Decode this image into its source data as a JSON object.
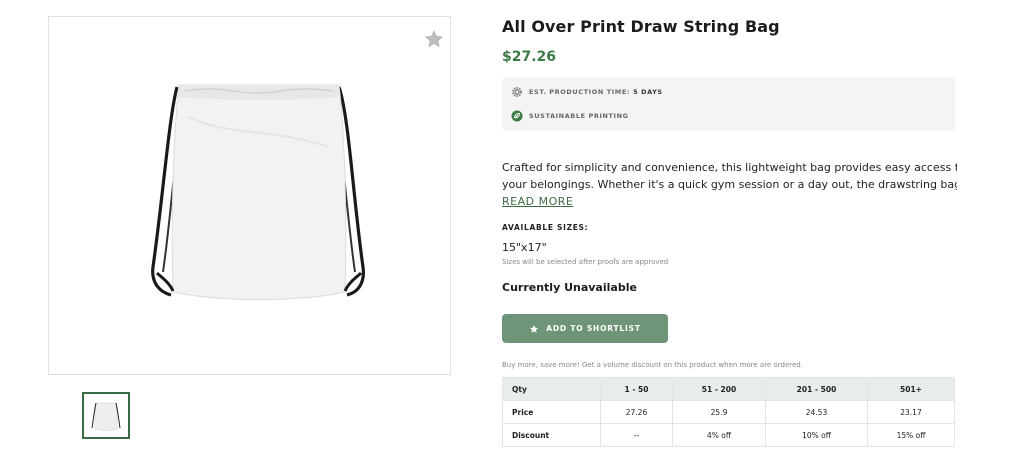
{
  "product": {
    "title": "All Over Print Draw String Bag",
    "price": "$27.26",
    "production_label": "EST. PRODUCTION TIME:",
    "production_value": "5 DAYS",
    "sustainable_label": "SUSTAINABLE PRINTING",
    "description_line1": "Crafted for simplicity and convenience, this lightweight bag provides easy access to",
    "description_line2": "your belongings. Whether it's a quick gym session or a day out, the drawstring bag i…",
    "read_more": "READ MORE",
    "sizes_label": "AVAILABLE SIZES:",
    "size_value": "15\"x17\"",
    "size_note": "Sizes will be selected after proofs are approved",
    "availability": "Currently Unavailable",
    "shortlist_button": "ADD TO SHORTLIST",
    "volume_note": "Buy more, save more! Get a volume discount on this product when more are ordered."
  },
  "volume_table": {
    "headers": [
      "Qty",
      "1 - 50",
      "51 - 200",
      "201 - 500",
      "501+"
    ],
    "rows": [
      [
        "Price",
        "27.26",
        "25.9",
        "24.53",
        "23.17"
      ],
      [
        "Discount",
        "--",
        "4% off",
        "10% off",
        "15% off"
      ]
    ]
  },
  "colors": {
    "accent_green": "#3e7a46",
    "button_green": "#6f9578",
    "table_header": "#e7ede9"
  },
  "icons": {
    "favorite": "star-icon",
    "production": "gear-icon",
    "sustainable": "leaf-icon",
    "shortlist": "star-icon"
  }
}
